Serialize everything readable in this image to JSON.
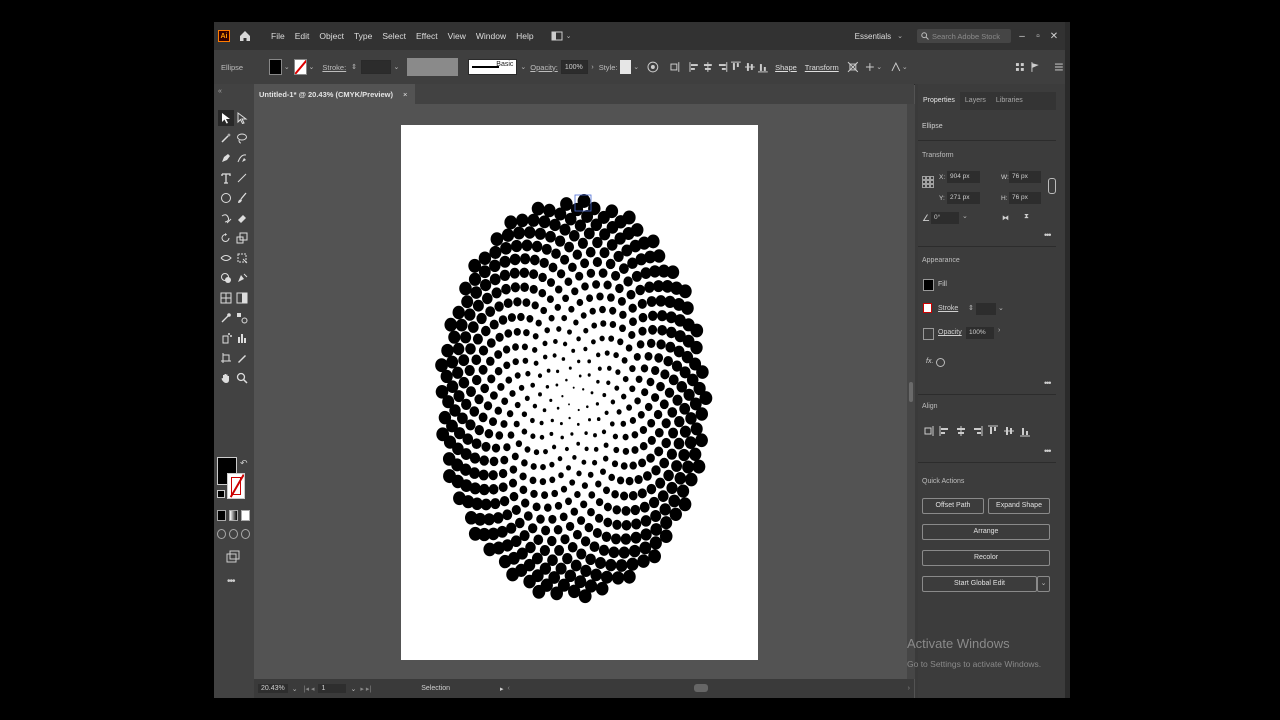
{
  "menubar": {
    "logo": "Ai",
    "items": [
      "File",
      "Edit",
      "Object",
      "Type",
      "Select",
      "Effect",
      "View",
      "Window",
      "Help"
    ],
    "workspace": "Essentials",
    "search_placeholder": "Search Adobe Stock"
  },
  "controlbar": {
    "selection_type": "Ellipse",
    "stroke_label": "Stroke:",
    "brush_label": "Basic",
    "opacity_label": "Opacity:",
    "opacity_value": "100%",
    "style_label": "Style:",
    "shape_label": "Shape",
    "transform_label": "Transform"
  },
  "document": {
    "tab_title": "Untitled-1* @ 20.43% (CMYK/Preview)",
    "close_symbol": "×"
  },
  "statusbar": {
    "zoom": "20.43%",
    "artboard_number": "1",
    "tool_name": "Selection"
  },
  "panel": {
    "tabs": [
      "Properties",
      "Layers",
      "Libraries"
    ],
    "object_type": "Ellipse",
    "transform": {
      "heading": "Transform",
      "x_label": "X:",
      "x_value": "904 px",
      "y_label": "Y:",
      "y_value": "271 px",
      "w_label": "W:",
      "w_value": "76 px",
      "h_label": "H:",
      "h_value": "76 px",
      "angle_value": "0°"
    },
    "appearance": {
      "heading": "Appearance",
      "fill_label": "Fill",
      "stroke_label": "Stroke",
      "opacity_label": "Opacity",
      "opacity_value": "100%",
      "fx_label": "fx."
    },
    "align": {
      "heading": "Align"
    },
    "quick_actions": {
      "heading": "Quick Actions",
      "offset_path": "Offset Path",
      "expand_shape": "Expand Shape",
      "arrange": "Arrange",
      "recolor": "Recolor",
      "start_global_edit": "Start Global Edit"
    }
  },
  "watermark": {
    "title": "Activate Windows",
    "subtitle": "Go to Settings to activate Windows."
  },
  "colors": {
    "app_bg": "#535353",
    "menubar_bg": "#323232",
    "panel_bg": "#3c3c3c",
    "artboard": "#ffffff",
    "dots": "#000000"
  },
  "icons": {
    "home": "home-icon",
    "search": "search-icon",
    "arrange_documents": "arrange-documents-icon"
  }
}
